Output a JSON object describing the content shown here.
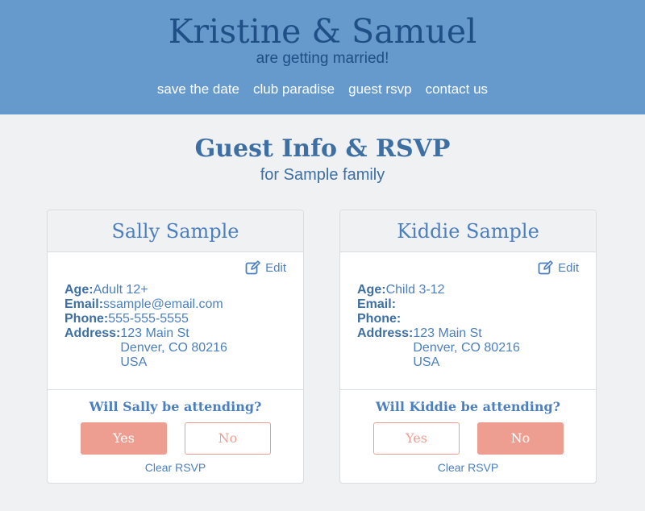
{
  "site": {
    "title": "Kristine & Samuel",
    "tagline": "are getting married!",
    "nav": [
      "save the date",
      "club paradise",
      "guest rsvp",
      "contact us"
    ]
  },
  "page": {
    "title": "Guest Info & RSVP",
    "subtitle": "for Sample family"
  },
  "guests": [
    {
      "name": "Sally Sample",
      "edit_label": "Edit",
      "age_label": "Age:",
      "age": "Adult 12+",
      "email_label": "Email:",
      "email": "ssample@email.com",
      "phone_label": "Phone:",
      "phone": "555-555-5555",
      "address_label": "Address:",
      "address_line1": "123 Main St",
      "address_line2": "Denver, CO 80216",
      "address_line3": "USA",
      "question": "Will Sally be attending?",
      "yes_label": "Yes",
      "no_label": "No",
      "selected": "Yes",
      "clear_label": "Clear RSVP"
    },
    {
      "name": "Kiddie Sample",
      "edit_label": "Edit",
      "age_label": "Age:",
      "age": "Child 3-12",
      "email_label": "Email:",
      "email": "",
      "phone_label": "Phone:",
      "phone": "",
      "address_label": "Address:",
      "address_line1": "123 Main St",
      "address_line2": "Denver, CO 80216",
      "address_line3": "USA",
      "question": "Will Kiddie be attending?",
      "yes_label": "Yes",
      "no_label": "No",
      "selected": "No",
      "clear_label": "Clear RSVP"
    }
  ],
  "colors": {
    "header_bg": "#6699cc",
    "title_blue": "#1f4f86",
    "accent_blue": "#4b7fbf",
    "button_salmon": "#ed9e90",
    "page_bg": "#eff1f3"
  },
  "icons": {
    "edit": "edit-icon"
  }
}
